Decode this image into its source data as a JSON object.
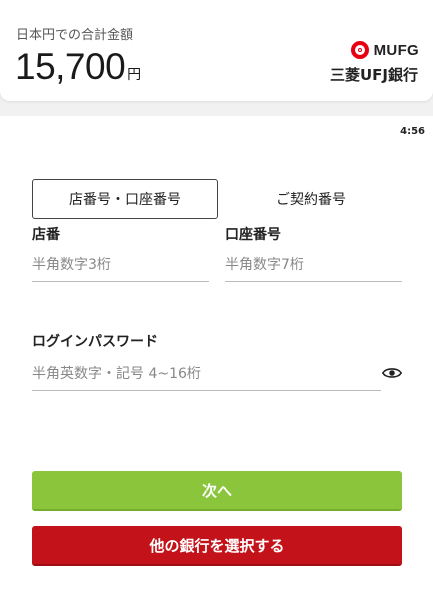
{
  "header": {
    "total_label": "日本円での合計金額",
    "amount": "15,700",
    "currency": "円",
    "bank_logo_text": "MUFG",
    "bank_name": "三菱UFJ銀行",
    "icon": "mufg-logo-icon",
    "brand_color": "#e60012"
  },
  "status": {
    "time": "4:56"
  },
  "tabs": [
    {
      "label": "店番号・口座番号",
      "active": true
    },
    {
      "label": "ご契約番号",
      "active": false
    }
  ],
  "form": {
    "branch": {
      "label": "店番",
      "placeholder": "半角数字3桁",
      "value": ""
    },
    "account": {
      "label": "口座番号",
      "placeholder": "半角数字7桁",
      "value": ""
    },
    "password": {
      "label": "ログインパスワード",
      "placeholder": "半角英数字・記号 4~16桁",
      "value": "",
      "icon": "eye-icon"
    }
  },
  "buttons": {
    "next_label": "次へ",
    "next_color": "#8ac53c",
    "other_bank_label": "他の銀行を選択する",
    "other_bank_color": "#c4121a"
  }
}
